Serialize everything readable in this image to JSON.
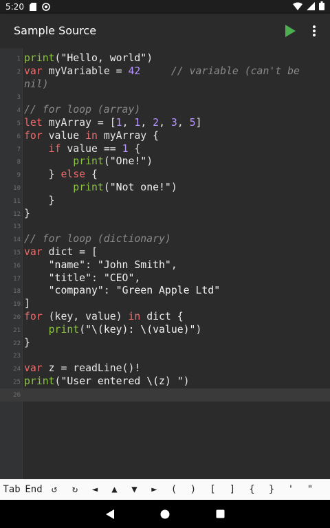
{
  "status_bar": {
    "time": "5:20",
    "left_icons": [
      "sd-card-icon",
      "vpn-icon"
    ],
    "right_icons": [
      "wifi-icon",
      "signal-icon",
      "battery-icon"
    ]
  },
  "app_bar": {
    "title": "Sample Source",
    "run_icon_color": "#4caf50",
    "actions": [
      "play-icon",
      "more-vert-icon"
    ]
  },
  "editor": {
    "current_line": 26,
    "lines": [
      {
        "n": "1",
        "code": "print(\"Hello, world\")"
      },
      {
        "n": "2",
        "code": "var myVariable = 42     // variable (can't be"
      },
      {
        "n": "",
        "code": "nil)"
      },
      {
        "n": "3",
        "code": ""
      },
      {
        "n": "4",
        "code": "// for loop (array)"
      },
      {
        "n": "5",
        "code": "let myArray = [1, 1, 2, 3, 5]"
      },
      {
        "n": "6",
        "code": "for value in myArray {"
      },
      {
        "n": "7",
        "code": "    if value == 1 {"
      },
      {
        "n": "8",
        "code": "        print(\"One!\")"
      },
      {
        "n": "9",
        "code": "    } else {"
      },
      {
        "n": "10",
        "code": "        print(\"Not one!\")"
      },
      {
        "n": "11",
        "code": "    }"
      },
      {
        "n": "12",
        "code": "}"
      },
      {
        "n": "13",
        "code": ""
      },
      {
        "n": "14",
        "code": "// for loop (dictionary)"
      },
      {
        "n": "15",
        "code": "var dict = ["
      },
      {
        "n": "16",
        "code": "    \"name\": \"John Smith\","
      },
      {
        "n": "17",
        "code": "    \"title\": \"CEO\","
      },
      {
        "n": "18",
        "code": "    \"company\": \"Green Apple Ltd\""
      },
      {
        "n": "19",
        "code": "]"
      },
      {
        "n": "20",
        "code": "for (key, value) in dict {"
      },
      {
        "n": "21",
        "code": "    print(\"\\(key): \\(value)\")"
      },
      {
        "n": "22",
        "code": "}"
      },
      {
        "n": "23",
        "code": ""
      },
      {
        "n": "24",
        "code": "var z = readLine()!"
      },
      {
        "n": "25",
        "code": "print(\"User entered \\(z) \")"
      },
      {
        "n": "26",
        "code": ""
      }
    ]
  },
  "key_bar": {
    "keys": [
      "Tab",
      "End",
      "↺",
      "↻",
      "◄",
      "▲",
      "▼",
      "►",
      "(",
      ")",
      "[",
      "]",
      "{",
      "}",
      "'",
      "\""
    ]
  },
  "nav_bar": {
    "buttons": [
      "back-icon",
      "home-icon",
      "recents-icon"
    ]
  },
  "colors": {
    "keyword": "#ef6c6c",
    "number": "#b793ff",
    "function": "#8cc63f",
    "comment": "#8a8a8a",
    "background": "#2b2b2b"
  }
}
